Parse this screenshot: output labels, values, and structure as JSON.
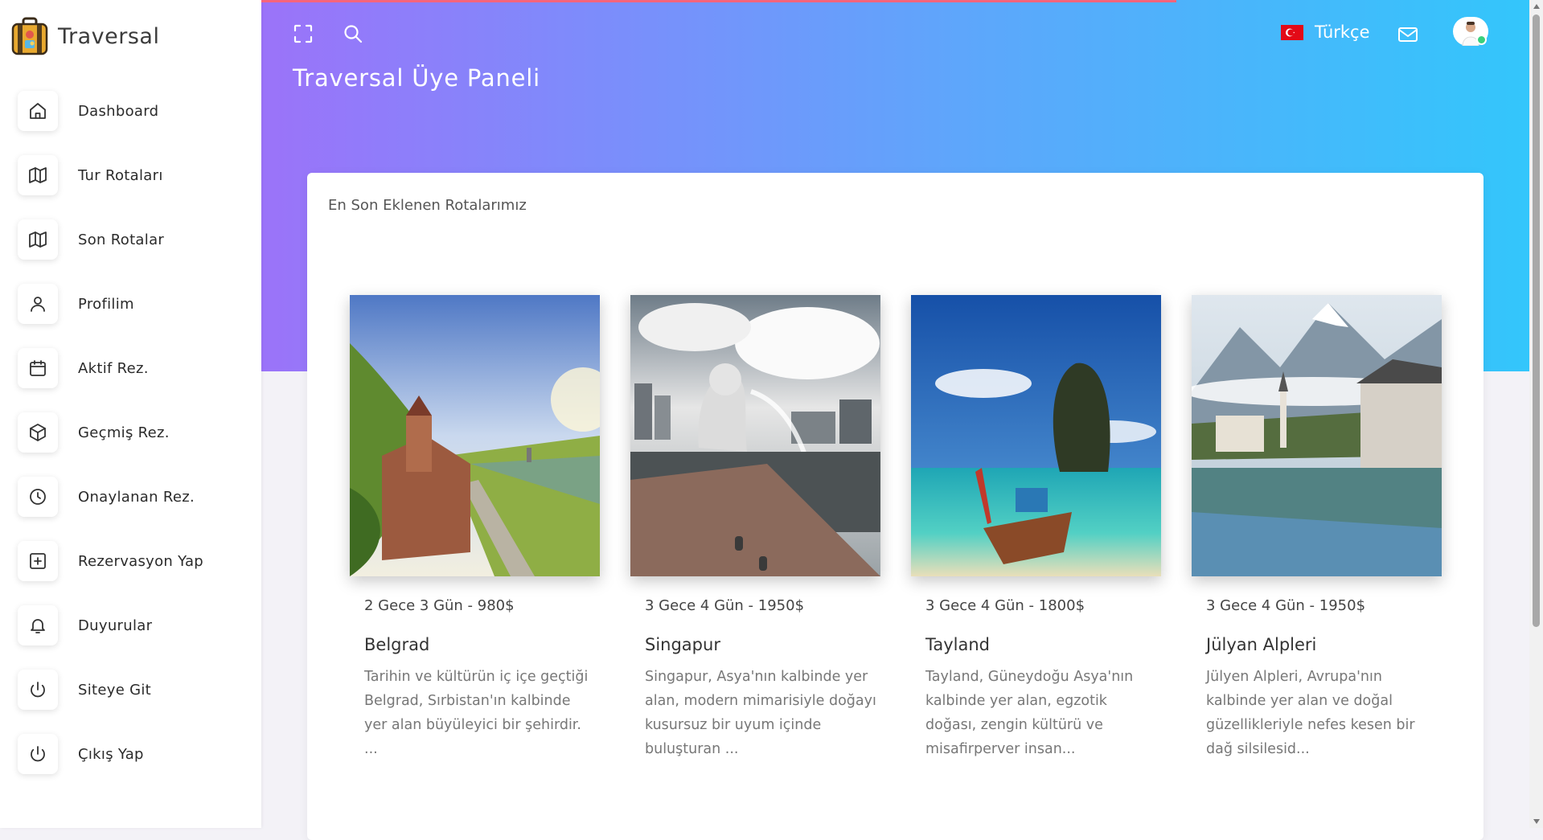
{
  "brand": {
    "name": "Traversal"
  },
  "sidebar": {
    "items": [
      {
        "label": "Dashboard",
        "icon": "home-icon"
      },
      {
        "label": "Tur Rotaları",
        "icon": "map-icon"
      },
      {
        "label": "Son Rotalar",
        "icon": "map-icon"
      },
      {
        "label": "Profilim",
        "icon": "user-icon"
      },
      {
        "label": "Aktif Rez.",
        "icon": "calendar-icon"
      },
      {
        "label": "Geçmiş Rez.",
        "icon": "box-icon"
      },
      {
        "label": "Onaylanan Rez.",
        "icon": "clock-icon"
      },
      {
        "label": "Rezervasyon Yap",
        "icon": "plus-square-icon"
      },
      {
        "label": "Duyurular",
        "icon": "bell-icon"
      },
      {
        "label": "Siteye Git",
        "icon": "power-icon"
      },
      {
        "label": "Çıkış Yap",
        "icon": "power-icon"
      }
    ]
  },
  "header": {
    "title": "Traversal Üye Paneli",
    "language": "Türkçe",
    "icons": [
      "fullscreen-icon",
      "search-icon",
      "mail-icon"
    ],
    "progress": 0.72
  },
  "main": {
    "section_title": "En Son Eklenen Rotalarımız",
    "tours": [
      {
        "price": "2 Gece 3 Gün - 980$",
        "name": "Belgrad",
        "description": "Tarihin ve kültürün iç içe geçtiği Belgrad, Sırbistan'ın kalbinde yer alan büyüleyici bir şehirdir. ..."
      },
      {
        "price": "3 Gece 4 Gün - 1950$",
        "name": "Singapur",
        "description": "Singapur, Asya'nın kalbinde yer alan, modern mimarisiyle doğayı kusursuz bir uyum içinde buluşturan ..."
      },
      {
        "price": "3 Gece 4 Gün - 1800$",
        "name": "Tayland",
        "description": "Tayland, Güneydoğu Asya'nın kalbinde yer alan, egzotik doğası, zengin kültürü ve misafirperver insan..."
      },
      {
        "price": "3 Gece 4 Gün - 1950$",
        "name": "Jülyan Alpleri",
        "description": "Jülyen Alpleri, Avrupa'nın kalbinde yer alan ve doğal güzellikleriyle nefes kesen bir dağ silsilesid..."
      }
    ]
  },
  "colors": {
    "gradient_start": "#9b73f9",
    "gradient_end": "#33c6fb",
    "progress": "#f6647c",
    "online": "#39d07d"
  }
}
